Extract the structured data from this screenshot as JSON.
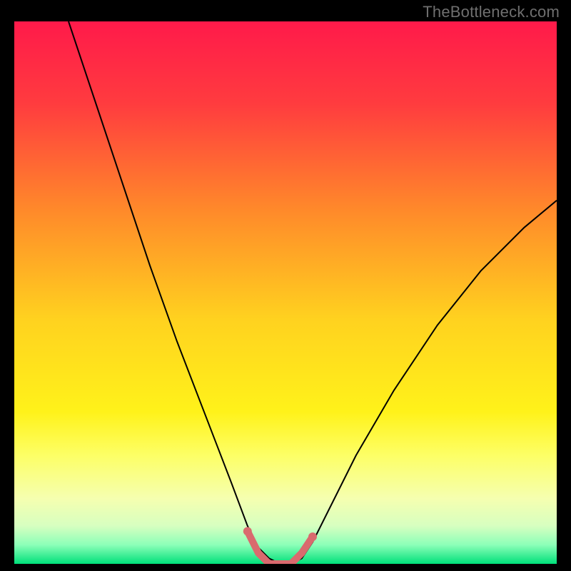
{
  "watermark": "TheBottleneck.com",
  "chart_data": {
    "type": "line",
    "title": "",
    "xlabel": "",
    "ylabel": "",
    "xlim": [
      0,
      100
    ],
    "ylim": [
      0,
      100
    ],
    "grid": false,
    "legend": false,
    "background_gradient": {
      "stops": [
        {
          "offset": 0.0,
          "color": "#ff1a4a"
        },
        {
          "offset": 0.15,
          "color": "#ff3b3f"
        },
        {
          "offset": 0.35,
          "color": "#ff8a2a"
        },
        {
          "offset": 0.55,
          "color": "#ffd21f"
        },
        {
          "offset": 0.72,
          "color": "#fff21a"
        },
        {
          "offset": 0.8,
          "color": "#fdff66"
        },
        {
          "offset": 0.88,
          "color": "#f5ffb0"
        },
        {
          "offset": 0.93,
          "color": "#d7ffc0"
        },
        {
          "offset": 0.965,
          "color": "#8cffb8"
        },
        {
          "offset": 1.0,
          "color": "#00e07a"
        }
      ]
    },
    "series": [
      {
        "name": "bottleneck-curve",
        "stroke": "#000000",
        "stroke_width": 2,
        "x": [
          10,
          15,
          20,
          25,
          30,
          35,
          40,
          43,
          45,
          47,
          49,
          51,
          53,
          55,
          58,
          63,
          70,
          78,
          86,
          94,
          100
        ],
        "y": [
          100,
          85,
          70,
          55,
          41,
          28,
          15,
          7,
          3,
          1,
          0,
          0,
          1,
          4,
          10,
          20,
          32,
          44,
          54,
          62,
          67
        ]
      },
      {
        "name": "bottom-highlight",
        "stroke": "#d96a6e",
        "stroke_width": 10,
        "linecap": "round",
        "x": [
          43,
          45,
          47,
          49,
          51,
          53,
          55
        ],
        "y": [
          6,
          2,
          0,
          0,
          0,
          2,
          5
        ]
      }
    ],
    "markers": {
      "name": "highlight-endpoints",
      "fill": "#d96a6e",
      "r": 6,
      "x": [
        43,
        55
      ],
      "y": [
        6,
        5
      ]
    }
  }
}
